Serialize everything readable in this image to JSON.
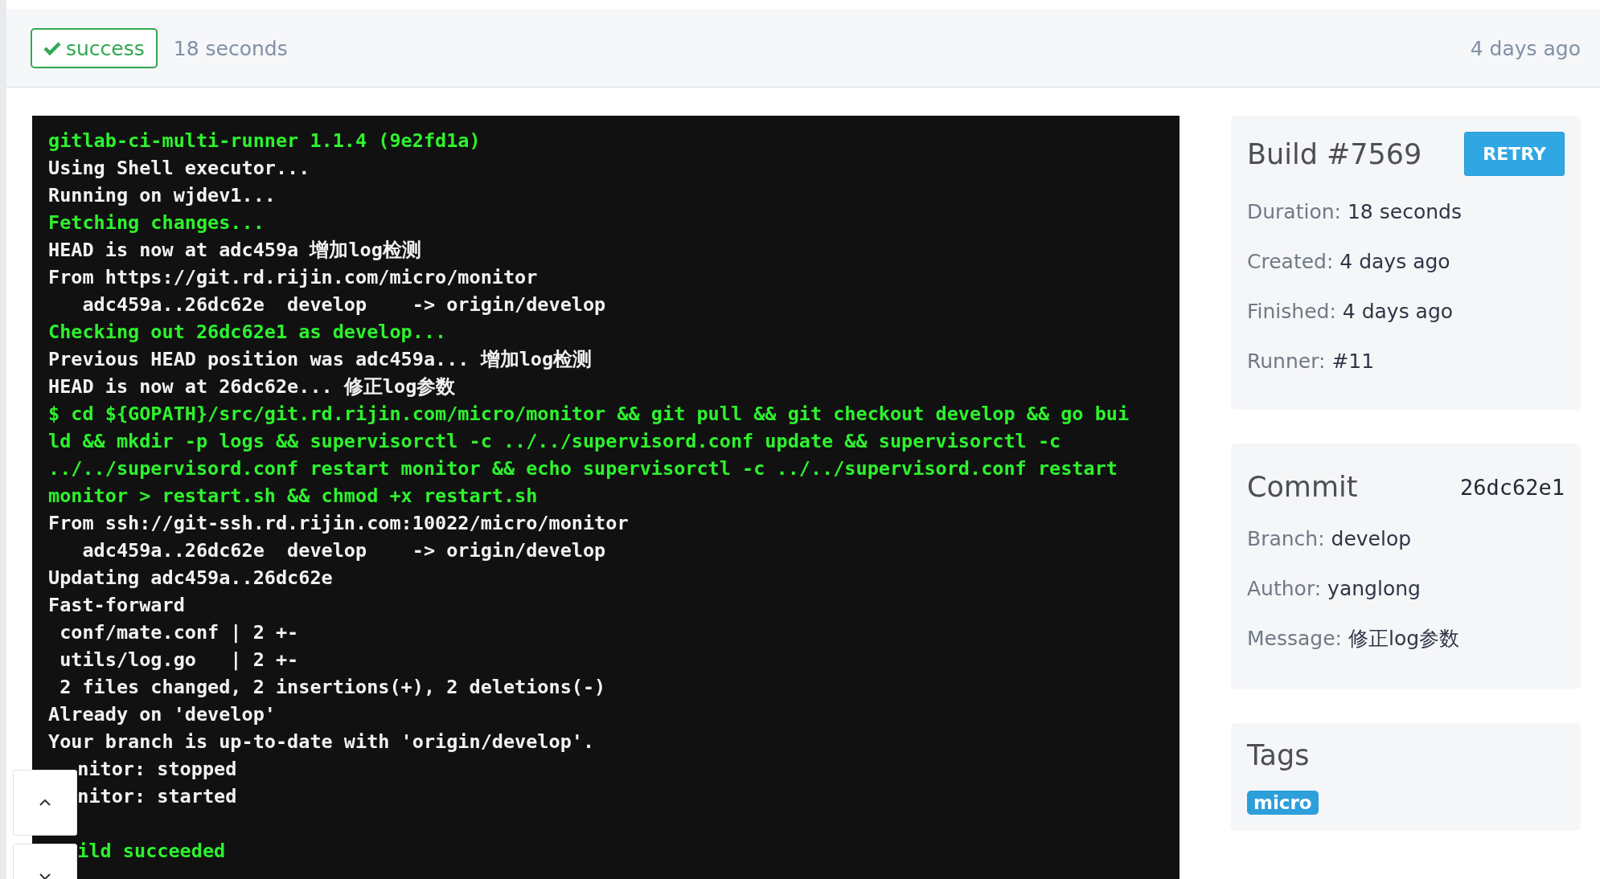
{
  "header": {
    "status": {
      "label": "success",
      "kind": "success"
    },
    "duration": "18 seconds",
    "time": "4 days ago"
  },
  "log": [
    {
      "text": "gitlab-ci-multi-runner 1.1.4 (9e2fd1a)",
      "kind": "command"
    },
    {
      "text": "Using Shell executor...",
      "kind": "output"
    },
    {
      "text": "Running on wjdev1...",
      "kind": "output"
    },
    {
      "text": "Fetching changes...",
      "kind": "command"
    },
    {
      "text": "HEAD is now at adc459a 增加log检测",
      "kind": "output"
    },
    {
      "text": "From https://git.rd.rijin.com/micro/monitor",
      "kind": "output"
    },
    {
      "text": "   adc459a..26dc62e  develop    -> origin/develop",
      "kind": "output"
    },
    {
      "text": "Checking out 26dc62e1 as develop...",
      "kind": "command"
    },
    {
      "text": "Previous HEAD position was adc459a... 增加log检测",
      "kind": "output"
    },
    {
      "text": "HEAD is now at 26dc62e... 修正log参数",
      "kind": "output"
    },
    {
      "text": "$ cd ${GOPATH}/src/git.rd.rijin.com/micro/monitor && git pull && git checkout develop && go bui",
      "kind": "command"
    },
    {
      "text": "ld && mkdir -p logs && supervisorctl -c ../../supervisord.conf update && supervisorctl -c",
      "kind": "command"
    },
    {
      "text": "../../supervisord.conf restart monitor && echo supervisorctl -c ../../supervisord.conf restart",
      "kind": "command"
    },
    {
      "text": "monitor > restart.sh && chmod +x restart.sh",
      "kind": "command"
    },
    {
      "text": "From ssh://git-ssh.rd.rijin.com:10022/micro/monitor",
      "kind": "output"
    },
    {
      "text": "   adc459a..26dc62e  develop    -> origin/develop",
      "kind": "output"
    },
    {
      "text": "Updating adc459a..26dc62e",
      "kind": "output"
    },
    {
      "text": "Fast-forward",
      "kind": "output"
    },
    {
      "text": " conf/mate.conf | 2 +-",
      "kind": "output"
    },
    {
      "text": " utils/log.go   | 2 +-",
      "kind": "output"
    },
    {
      "text": " 2 files changed, 2 insertions(+), 2 deletions(-)",
      "kind": "output"
    },
    {
      "text": "Already on 'develop'",
      "kind": "output"
    },
    {
      "text": "Your branch is up-to-date with 'origin/develop'.",
      "kind": "output"
    },
    {
      "text": "nitor: stopped",
      "kind": "output",
      "covered": true
    },
    {
      "text": "nitor: started",
      "kind": "output",
      "covered": true
    },
    {
      "kind": "blank"
    },
    {
      "text": "ild succeeded",
      "kind": "command",
      "covered": true
    }
  ],
  "build": {
    "title": "Build #7569",
    "retry": "RETRY",
    "fields": [
      {
        "label": "Duration:",
        "value": "18 seconds"
      },
      {
        "label": "Created:",
        "value": "4 days ago"
      },
      {
        "label": "Finished:",
        "value": "4 days ago"
      },
      {
        "label": "Runner:",
        "value": "#11"
      }
    ]
  },
  "commit": {
    "title": "Commit",
    "sha": "26dc62e1",
    "fields": [
      {
        "label": "Branch:",
        "value": "develop"
      },
      {
        "label": "Author:",
        "value": "yanglong"
      },
      {
        "label": "Message:",
        "value": "修正log参数"
      }
    ]
  },
  "tags": {
    "title": "Tags",
    "items": [
      "micro"
    ]
  }
}
